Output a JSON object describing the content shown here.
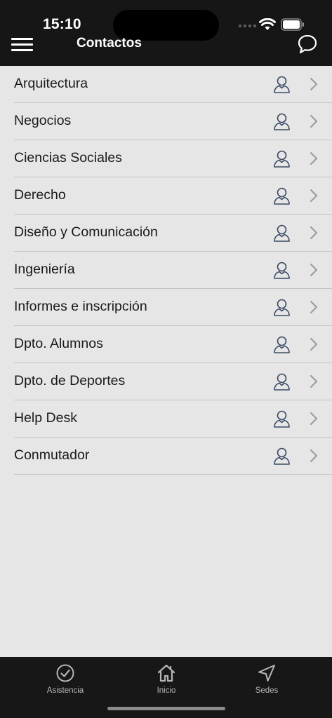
{
  "status_bar": {
    "time": "15:10"
  },
  "header": {
    "title": "Contactos"
  },
  "contacts": [
    {
      "label": "Arquitectura"
    },
    {
      "label": "Negocios"
    },
    {
      "label": "Ciencias Sociales"
    },
    {
      "label": "Derecho"
    },
    {
      "label": "Diseño y Comunicación"
    },
    {
      "label": "Ingeniería"
    },
    {
      "label": "Informes e inscripción"
    },
    {
      "label": "Dpto. Alumnos"
    },
    {
      "label": "Dpto. de Deportes"
    },
    {
      "label": "Help Desk"
    },
    {
      "label": "Conmutador"
    }
  ],
  "tabs": [
    {
      "label": "Asistencia",
      "icon": "check-circle-icon"
    },
    {
      "label": "Inicio",
      "icon": "home-icon"
    },
    {
      "label": "Sedes",
      "icon": "location-arrow-icon"
    }
  ],
  "colors": {
    "header_bg": "#161616",
    "list_bg": "#e6e6e6",
    "divider": "#c4c4c4",
    "person_icon": "#3b4a63",
    "chevron": "#9a9a9a",
    "tab_icon": "#b5b5b5"
  }
}
